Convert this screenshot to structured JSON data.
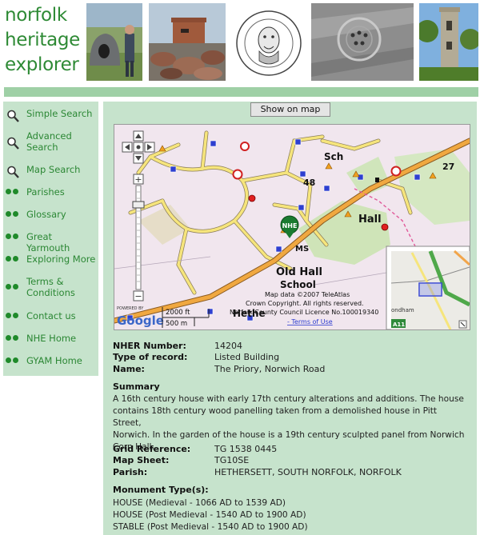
{
  "site": {
    "logo_line1": "norfolk",
    "logo_line2": "heritage",
    "logo_line3": "explorer"
  },
  "nav": {
    "items": [
      {
        "label": "Simple Search",
        "icon": "magnifier-icon"
      },
      {
        "label": "Advanced Search",
        "icon": "magnifier-icon"
      },
      {
        "label": "Map Search",
        "icon": "magnifier-icon"
      },
      {
        "label": "Parishes",
        "icon": "green-dots-icon"
      },
      {
        "label": "Glossary",
        "icon": "green-dots-icon"
      },
      {
        "label": "Great Yarmouth",
        "icon": "green-dots-icon"
      },
      {
        "label": "Exploring More",
        "icon": "green-dots-icon"
      },
      {
        "label": "Terms & Conditions",
        "icon": "green-dots-icon"
      },
      {
        "label": "Contact us",
        "icon": "green-dots-icon"
      },
      {
        "label": "NHE Home",
        "icon": "green-dots-icon"
      },
      {
        "label": "GYAM Home",
        "icon": "green-dots-icon"
      }
    ]
  },
  "map": {
    "show_button": "Show on map",
    "copyright_line1": "Map data ©2007 TeleAtlas",
    "copyright_line2": "Crown Copyright. All rights reserved.",
    "copyright_line3": "Norfolk County Council Licence No.100019340",
    "terms_link": "- Terms of Use",
    "scale_ft": "2000 ft",
    "scale_m": "500 m",
    "powered_by": "POWERED BY",
    "google": "Google",
    "marker_label": "NHE",
    "labels": {
      "sch": "Sch",
      "hall": "Hall",
      "ms": "MS",
      "old_hall": "Old Hall",
      "school": "School",
      "n48": "48",
      "n27": "27",
      "hethersett": "Hethe",
      "a11": "A11",
      "ondham": "ondham"
    }
  },
  "record": {
    "nher_label": "NHER Number:",
    "nher_value": "14204",
    "type_label": "Type of record:",
    "type_value": "Listed Building",
    "name_label": "Name:",
    "name_value": "The Priory, Norwich Road",
    "summary_heading": "Summary",
    "summary_line1": "A 16th century house with early 17th century alterations and additions. The house",
    "summary_line2": "contains 18th century wood panelling taken from a demolished house in Pitt Street,",
    "summary_line3": "Norwich. In the garden of the house is a 19th century sculpted panel from Norwich",
    "summary_line4": "Corn Hall.",
    "grid_label": "Grid Reference:",
    "grid_value": "TG 1538 0445",
    "sheet_label": "Map Sheet:",
    "sheet_value": "TG10SE",
    "parish_label": "Parish:",
    "parish_value": "HETHERSETT, SOUTH NORFOLK, NORFOLK",
    "monument_heading": "Monument Type(s):",
    "monuments": [
      "HOUSE (Medieval - 1066 AD to 1539 AD)",
      "HOUSE (Post Medieval - 1540 AD to 1900 AD)",
      "STABLE (Post Medieval - 1540 AD to 1900 AD)"
    ]
  }
}
